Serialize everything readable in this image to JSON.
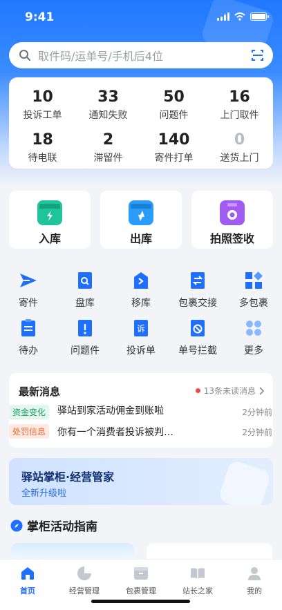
{
  "status_bar": {
    "time": "9:41"
  },
  "search": {
    "placeholder": "取件码/运单号/手机后4位",
    "icon": "search-icon",
    "scan_icon": "scan-icon"
  },
  "stats": [
    {
      "num": "10",
      "label": "投诉工单"
    },
    {
      "num": "33",
      "label": "通知失败"
    },
    {
      "num": "50",
      "label": "问题件"
    },
    {
      "num": "16",
      "label": "上门取件"
    },
    {
      "num": "18",
      "label": "待电联"
    },
    {
      "num": "2",
      "label": "滞留件"
    },
    {
      "num": "140",
      "label": "寄件打单"
    },
    {
      "num": "0",
      "label": "送货上门"
    }
  ],
  "big_actions": [
    {
      "label": "入库",
      "icon": "inbound-box-icon",
      "color": "#1fc59a"
    },
    {
      "label": "出库",
      "icon": "outbound-box-icon",
      "color": "#2a9dfb"
    },
    {
      "label": "拍照签收",
      "icon": "camera-icon",
      "color": "#a05bf0"
    }
  ],
  "grid": [
    {
      "label": "寄件",
      "icon": "send-icon"
    },
    {
      "label": "盘库",
      "icon": "inventory-icon"
    },
    {
      "label": "移库",
      "icon": "move-icon"
    },
    {
      "label": "包裹交接",
      "icon": "handover-icon"
    },
    {
      "label": "多包裹",
      "icon": "multi-package-icon"
    },
    {
      "label": "待办",
      "icon": "todo-icon"
    },
    {
      "label": "问题件",
      "icon": "problem-icon"
    },
    {
      "label": "投诉单",
      "icon": "complaint-icon"
    },
    {
      "label": "单号拦截",
      "icon": "intercept-icon"
    },
    {
      "label": "更多",
      "icon": "more-icon"
    }
  ],
  "news": {
    "title": "最新消息",
    "unread": "13条未读消息",
    "items": [
      {
        "tag": "资金变化",
        "text": "驿站到家活动佣金到账啦",
        "time": "2分钟前"
      },
      {
        "tag": "处罚信息",
        "text": "你有一个消费者投诉被判…",
        "time": "2分钟前"
      }
    ]
  },
  "banner": {
    "title": "驿站掌柜·经营管家",
    "subtitle": "全新升级啦"
  },
  "guide": {
    "title": "掌柜活动指南"
  },
  "tabs": [
    {
      "label": "首页",
      "icon": "home-icon"
    },
    {
      "label": "经营管理",
      "icon": "pie-chart-icon"
    },
    {
      "label": "包裹管理",
      "icon": "package-icon"
    },
    {
      "label": "站长之家",
      "icon": "book-icon"
    },
    {
      "label": "我的",
      "icon": "user-icon"
    }
  ],
  "colors": {
    "primary": "#1f6fff",
    "accent_green": "#1fc59a",
    "accent_purple": "#a05bf0",
    "unread_dot": "#f04a4a"
  }
}
